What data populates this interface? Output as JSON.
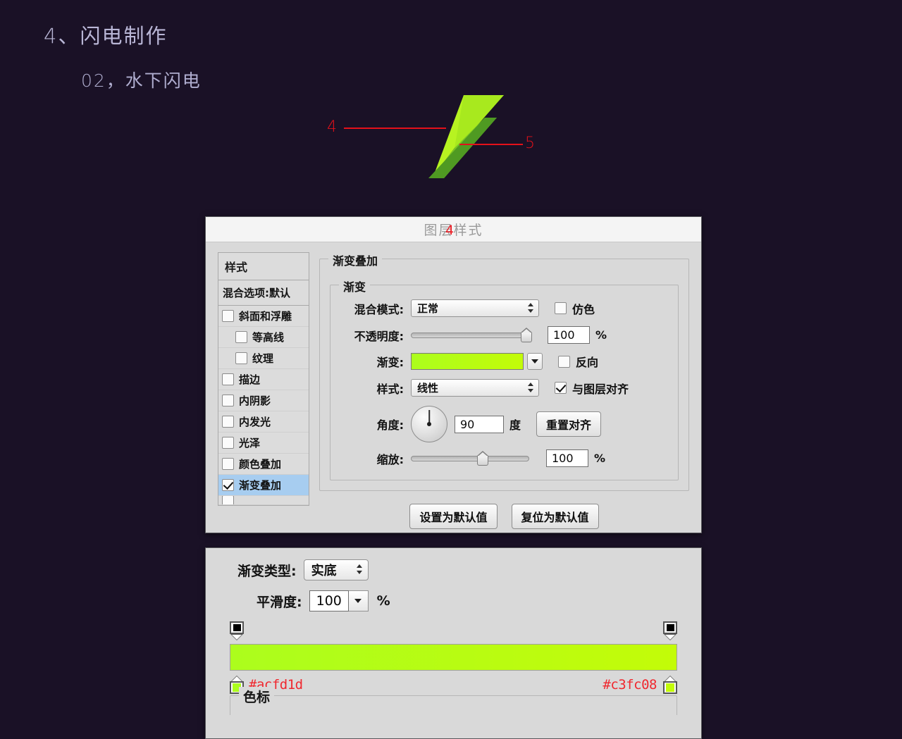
{
  "page": {
    "background_color": "#1a1126",
    "heading_1": "4、闪电制作",
    "heading_2": "02，水下闪电"
  },
  "illustration": {
    "name": "lightning-bolt-shape",
    "light_green": "#b7f321",
    "dark_green": "#4f9a22",
    "mid_green": "#79c425",
    "annotations": [
      {
        "label": "4",
        "side": "left"
      },
      {
        "label": "5",
        "side": "right"
      }
    ],
    "annotation_color": "#e4111a"
  },
  "dialog_top": {
    "title_number": "4",
    "title": "图层样式",
    "sidebar": {
      "header": "样式",
      "blending": "混合选项:默认",
      "items": [
        {
          "label": "斜面和浮雕",
          "checked": false,
          "indent": false,
          "selected": false
        },
        {
          "label": "等高线",
          "checked": false,
          "indent": true,
          "selected": false
        },
        {
          "label": "纹理",
          "checked": false,
          "indent": true,
          "selected": false
        },
        {
          "label": "描边",
          "checked": false,
          "indent": false,
          "selected": false
        },
        {
          "label": "内阴影",
          "checked": false,
          "indent": false,
          "selected": false
        },
        {
          "label": "内发光",
          "checked": false,
          "indent": false,
          "selected": false
        },
        {
          "label": "光泽",
          "checked": false,
          "indent": false,
          "selected": false
        },
        {
          "label": "颜色叠加",
          "checked": false,
          "indent": false,
          "selected": false
        },
        {
          "label": "渐变叠加",
          "checked": true,
          "indent": false,
          "selected": true
        }
      ]
    },
    "group_title": "渐变叠加",
    "inner_group_title": "渐变",
    "fields": {
      "blend_mode_label": "混合模式:",
      "blend_mode_value": "正常",
      "dither_label": "仿色",
      "dither_checked": false,
      "opacity_label": "不透明度:",
      "opacity_value": "100",
      "opacity_unit": "%",
      "gradient_label": "渐变:",
      "gradient_from": "#acfd1d",
      "gradient_to": "#c3fc08",
      "reverse_label": "反向",
      "reverse_checked": false,
      "style_label": "样式:",
      "style_value": "线性",
      "align_label": "与图层对齐",
      "align_checked": true,
      "angle_label": "角度:",
      "angle_value": "90",
      "angle_unit": "度",
      "reset_align_button": "重置对齐",
      "scale_label": "缩放:",
      "scale_value": "100",
      "scale_unit": "%"
    },
    "footer": {
      "set_default": "设置为默认值",
      "reset_default": "复位为默认值"
    }
  },
  "dialog_bottom": {
    "gradient_type_label": "渐变类型:",
    "gradient_type_value": "实底",
    "smoothness_label": "平滑度:",
    "smoothness_value": "100",
    "smoothness_unit": "%",
    "gradient_bar": {
      "start_color": "#acfd1d",
      "end_color": "#c3fc08",
      "start_hex_label": "#acfd1d",
      "end_hex_label": "#c3fc08",
      "hex_label_color": "#f0282f"
    },
    "color_stop_group_title": "色标"
  }
}
